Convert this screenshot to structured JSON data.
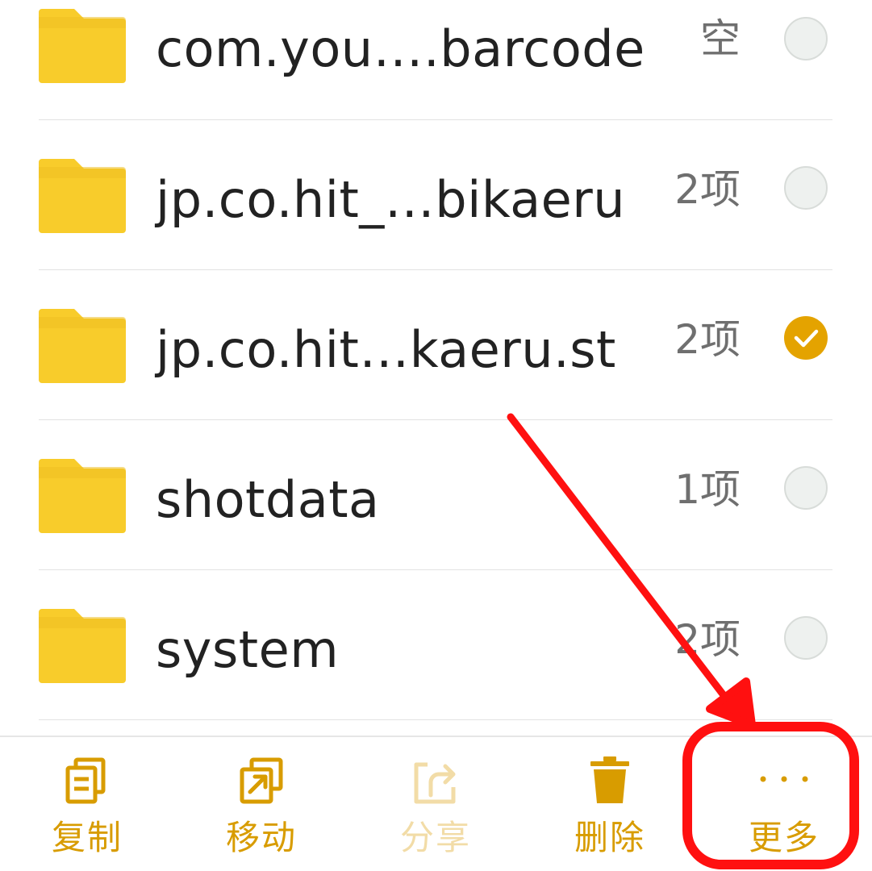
{
  "colors": {
    "folder": "#f8cc2b",
    "folder_tab": "#eebf22",
    "accent": "#d89c00",
    "check": "#e4a300",
    "annotation": "#ff1010"
  },
  "files": [
    {
      "name": "com.you….barcode",
      "count": "空",
      "selected": false,
      "icon": "folder-icon"
    },
    {
      "name": "jp.co.hit_…bikaeru",
      "count": "2项",
      "selected": false,
      "icon": "folder-icon"
    },
    {
      "name": "jp.co.hit…kaeru.st",
      "count": "2项",
      "selected": true,
      "icon": "folder-icon"
    },
    {
      "name": "shotdata",
      "count": "1项",
      "selected": false,
      "icon": "folder-icon"
    },
    {
      "name": "system",
      "count": "2项",
      "selected": false,
      "icon": "folder-icon"
    }
  ],
  "toolbar": {
    "copy_label": "复制",
    "move_label": "移动",
    "share_label": "分享",
    "delete_label": "删除",
    "more_label": "更多",
    "icons": {
      "copy": "copy-icon",
      "move": "move-icon",
      "share": "share-icon",
      "delete": "trash-icon",
      "more": "more-dots-icon"
    },
    "share_enabled": false
  }
}
